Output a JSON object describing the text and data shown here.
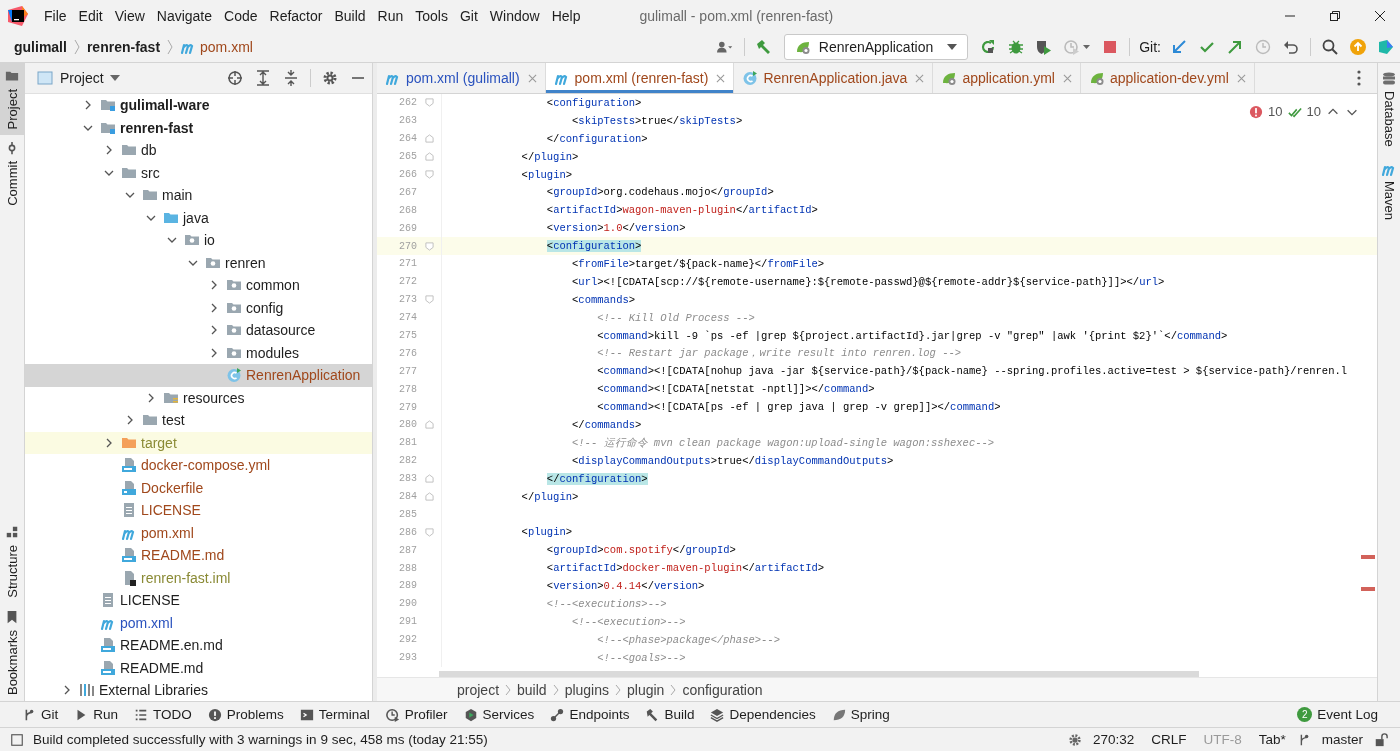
{
  "window": {
    "title": "gulimall - pom.xml (renren-fast)"
  },
  "menu": [
    "File",
    "Edit",
    "View",
    "Navigate",
    "Code",
    "Refactor",
    "Build",
    "Run",
    "Tools",
    "Git",
    "Window",
    "Help"
  ],
  "breadcrumbs": [
    {
      "label": "gulimall",
      "kind": "module"
    },
    {
      "label": "renren-fast",
      "kind": "module"
    },
    {
      "label": "pom.xml",
      "kind": "file"
    }
  ],
  "toolbar": {
    "run_config": "RenrenApplication",
    "git_label": "Git:"
  },
  "left_stripe": [
    {
      "label": "Project",
      "selected": true
    },
    {
      "label": "Commit",
      "selected": false
    }
  ],
  "left_stripe_bottom": [
    {
      "label": "Structure",
      "selected": false
    },
    {
      "label": "Bookmarks",
      "selected": false
    }
  ],
  "project_panel": {
    "title": "Project",
    "tree": [
      {
        "label": "gulimall-ware",
        "kind": "module",
        "color": "#1e1e1e",
        "expanded": false,
        "selected": false
      },
      {
        "label": "renren-fast",
        "kind": "module",
        "color": "#1e1e1e",
        "expanded": true,
        "selected": false,
        "children": [
          {
            "label": "db",
            "kind": "folder",
            "color": "#1e1e1e",
            "expanded": false,
            "selected": false
          },
          {
            "label": "src",
            "kind": "folder",
            "color": "#1e1e1e",
            "expanded": true,
            "selected": false,
            "children": [
              {
                "label": "main",
                "kind": "folder",
                "color": "#1e1e1e",
                "expanded": true,
                "selected": false,
                "children": [
                  {
                    "label": "java",
                    "kind": "source",
                    "color": "#1e1e1e",
                    "expanded": true,
                    "selected": false,
                    "children": [
                      {
                        "label": "io",
                        "kind": "package",
                        "color": "#1e1e1e",
                        "expanded": true,
                        "selected": false,
                        "children": [
                          {
                            "label": "renren",
                            "kind": "package",
                            "color": "#1e1e1e",
                            "expanded": true,
                            "selected": false,
                            "children": [
                              {
                                "label": "common",
                                "kind": "package",
                                "color": "#1e1e1e",
                                "expanded": false,
                                "selected": false
                              },
                              {
                                "label": "config",
                                "kind": "package",
                                "color": "#1e1e1e",
                                "expanded": false,
                                "selected": false
                              },
                              {
                                "label": "datasource",
                                "kind": "package",
                                "color": "#1e1e1e",
                                "expanded": false,
                                "selected": false
                              },
                              {
                                "label": "modules",
                                "kind": "package",
                                "color": "#1e1e1e",
                                "expanded": false,
                                "selected": false
                              },
                              {
                                "label": "RenrenApplication",
                                "kind": "class",
                                "color": "#a0481c",
                                "selected": true
                              }
                            ]
                          }
                        ]
                      }
                    ]
                  },
                  {
                    "label": "resources",
                    "kind": "resources",
                    "color": "#1e1e1e",
                    "expanded": false,
                    "selected": false
                  }
                ]
              },
              {
                "label": "test",
                "kind": "folder",
                "color": "#1e1e1e",
                "expanded": false,
                "selected": false
              }
            ]
          },
          {
            "label": "target",
            "kind": "excluded",
            "color": "#8a8a35",
            "expanded": false,
            "selected": false
          },
          {
            "label": "docker-compose.yml",
            "kind": "compose",
            "color": "#a0481c",
            "selected": false
          },
          {
            "label": "Dockerfile",
            "kind": "dockerfile",
            "color": "#a0481c",
            "selected": false
          },
          {
            "label": "LICENSE",
            "kind": "text",
            "color": "#a0481c",
            "selected": false
          },
          {
            "label": "pom.xml",
            "kind": "maven",
            "color": "#a0481c",
            "selected": false
          },
          {
            "label": "README.md",
            "kind": "markdown",
            "color": "#a0481c",
            "selected": false
          },
          {
            "label": "renren-fast.iml",
            "kind": "iml",
            "color": "#8a8a35",
            "selected": false
          }
        ]
      },
      {
        "label": "LICENSE",
        "kind": "text",
        "color": "#1e1e1e",
        "selected": false
      },
      {
        "label": "pom.xml",
        "kind": "maven",
        "color": "#2a52be",
        "selected": false
      },
      {
        "label": "README.en.md",
        "kind": "markdown",
        "color": "#1e1e1e",
        "selected": false
      },
      {
        "label": "README.md",
        "kind": "markdown",
        "color": "#1e1e1e",
        "selected": false
      }
    ],
    "libraries": {
      "label": "External Libraries",
      "expanded": false
    }
  },
  "tabs": [
    {
      "label": "pom.xml (gulimall)",
      "kind": "maven",
      "color": "#2a52be",
      "selected": false
    },
    {
      "label": "pom.xml (renren-fast)",
      "kind": "maven",
      "color": "#a0481c",
      "selected": true
    },
    {
      "label": "RenrenApplication.java",
      "kind": "class",
      "color": "#a0481c",
      "selected": false
    },
    {
      "label": "application.yml",
      "kind": "spring",
      "color": "#a0481c",
      "selected": false
    },
    {
      "label": "application-dev.yml",
      "kind": "spring",
      "color": "#a0481c",
      "selected": false
    }
  ],
  "editor": {
    "errors": "10",
    "checks": "10",
    "lines": [
      {
        "num": "262",
        "current": false,
        "kind": "fold_start",
        "code": [
          {
            "kind": "plain",
            "text": "                <"
          },
          {
            "kind": "tag",
            "text": "configuration"
          },
          {
            "kind": "plain",
            "text": ">"
          }
        ]
      },
      {
        "num": "263",
        "current": false,
        "kind": "plain",
        "code": [
          {
            "kind": "plain",
            "text": "                    <"
          },
          {
            "kind": "tag",
            "text": "skipTests"
          },
          {
            "kind": "plain",
            "text": ">true</"
          },
          {
            "kind": "tag",
            "text": "skipTests"
          },
          {
            "kind": "plain",
            "text": ">"
          }
        ]
      },
      {
        "num": "264",
        "current": false,
        "kind": "fold_end",
        "code": [
          {
            "kind": "plain",
            "text": "                </"
          },
          {
            "kind": "tag",
            "text": "configuration"
          },
          {
            "kind": "plain",
            "text": ">"
          }
        ]
      },
      {
        "num": "265",
        "current": false,
        "kind": "fold_end",
        "code": [
          {
            "kind": "plain",
            "text": "            </"
          },
          {
            "kind": "tag",
            "text": "plugin"
          },
          {
            "kind": "plain",
            "text": ">"
          }
        ]
      },
      {
        "num": "266",
        "current": false,
        "kind": "fold_start",
        "code": [
          {
            "kind": "plain",
            "text": "            <"
          },
          {
            "kind": "tag",
            "text": "plugin"
          },
          {
            "kind": "plain",
            "text": ">"
          }
        ]
      },
      {
        "num": "267",
        "current": false,
        "kind": "plain",
        "code": [
          {
            "kind": "plain",
            "text": "                <"
          },
          {
            "kind": "tag",
            "text": "groupId"
          },
          {
            "kind": "plain",
            "text": ">org.codehaus.mojo</"
          },
          {
            "kind": "tag",
            "text": "groupId"
          },
          {
            "kind": "plain",
            "text": ">"
          }
        ]
      },
      {
        "num": "268",
        "current": false,
        "kind": "plain",
        "code": [
          {
            "kind": "plain",
            "text": "                <"
          },
          {
            "kind": "tag",
            "text": "artifactId"
          },
          {
            "kind": "plain",
            "text": ">"
          },
          {
            "kind": "value",
            "text": "wagon-maven-plugin"
          },
          {
            "kind": "plain",
            "text": "</"
          },
          {
            "kind": "tag",
            "text": "artifactId"
          },
          {
            "kind": "plain",
            "text": ">"
          }
        ]
      },
      {
        "num": "269",
        "current": false,
        "kind": "plain",
        "code": [
          {
            "kind": "plain",
            "text": "                <"
          },
          {
            "kind": "tag",
            "text": "version"
          },
          {
            "kind": "plain",
            "text": ">"
          },
          {
            "kind": "value",
            "text": "1.0"
          },
          {
            "kind": "plain",
            "text": "</"
          },
          {
            "kind": "tag",
            "text": "version"
          },
          {
            "kind": "plain",
            "text": ">"
          }
        ]
      },
      {
        "num": "270",
        "current": true,
        "kind": "fold_start",
        "code": [
          {
            "kind": "match_plain",
            "text": "                <"
          },
          {
            "kind": "match_tag",
            "text": "configuration"
          },
          {
            "kind": "match_plain",
            "text": ">"
          }
        ]
      },
      {
        "num": "271",
        "current": false,
        "kind": "plain",
        "code": [
          {
            "kind": "plain",
            "text": "                    <"
          },
          {
            "kind": "tag",
            "text": "fromFile"
          },
          {
            "kind": "plain",
            "text": ">target/${pack-name}</"
          },
          {
            "kind": "tag",
            "text": "fromFile"
          },
          {
            "kind": "plain",
            "text": ">"
          }
        ]
      },
      {
        "num": "272",
        "current": false,
        "kind": "plain",
        "code": [
          {
            "kind": "plain",
            "text": "                    <"
          },
          {
            "kind": "tag",
            "text": "url"
          },
          {
            "kind": "plain",
            "text": "><![CDATA[scp://${remote-username}:${remote-passwd}@${remote-addr}${service-path}]]></"
          },
          {
            "kind": "tag",
            "text": "url"
          },
          {
            "kind": "plain",
            "text": ">"
          }
        ]
      },
      {
        "num": "273",
        "current": false,
        "kind": "fold_start",
        "code": [
          {
            "kind": "plain",
            "text": "                    <"
          },
          {
            "kind": "tag",
            "text": "commands"
          },
          {
            "kind": "plain",
            "text": ">"
          }
        ]
      },
      {
        "num": "274",
        "current": false,
        "kind": "plain",
        "code": [
          {
            "kind": "comment",
            "text": "                        <!-- Kill Old Process -->"
          }
        ]
      },
      {
        "num": "275",
        "current": false,
        "kind": "plain",
        "code": [
          {
            "kind": "plain",
            "text": "                        <"
          },
          {
            "kind": "tag",
            "text": "command"
          },
          {
            "kind": "plain",
            "text": ">kill -9 `ps -ef |grep ${project.artifactId}.jar|grep -v \"grep\" |awk '{print $2}'`</"
          },
          {
            "kind": "tag",
            "text": "command"
          },
          {
            "kind": "plain",
            "text": ">"
          }
        ]
      },
      {
        "num": "276",
        "current": false,
        "kind": "plain",
        "code": [
          {
            "kind": "comment",
            "text": "                        <!-- Restart jar package，write result into renren.log -->"
          }
        ]
      },
      {
        "num": "277",
        "current": false,
        "kind": "plain",
        "code": [
          {
            "kind": "plain",
            "text": "                        <"
          },
          {
            "kind": "tag",
            "text": "command"
          },
          {
            "kind": "plain",
            "text": "><![CDATA[nohup java -jar ${service-path}/${pack-name} --spring.profiles.active=test > ${service-path}/renren.l"
          }
        ]
      },
      {
        "num": "278",
        "current": false,
        "kind": "plain",
        "code": [
          {
            "kind": "plain",
            "text": "                        <"
          },
          {
            "kind": "tag",
            "text": "command"
          },
          {
            "kind": "plain",
            "text": "><![CDATA[netstat -nptl]]></"
          },
          {
            "kind": "tag",
            "text": "command"
          },
          {
            "kind": "plain",
            "text": ">"
          }
        ]
      },
      {
        "num": "279",
        "current": false,
        "kind": "plain",
        "code": [
          {
            "kind": "plain",
            "text": "                        <"
          },
          {
            "kind": "tag",
            "text": "command"
          },
          {
            "kind": "plain",
            "text": "><![CDATA[ps -ef | grep java | grep -v grep]]></"
          },
          {
            "kind": "tag",
            "text": "command"
          },
          {
            "kind": "plain",
            "text": ">"
          }
        ]
      },
      {
        "num": "280",
        "current": false,
        "kind": "fold_end",
        "code": [
          {
            "kind": "plain",
            "text": "                    </"
          },
          {
            "kind": "tag",
            "text": "commands"
          },
          {
            "kind": "plain",
            "text": ">"
          }
        ]
      },
      {
        "num": "281",
        "current": false,
        "kind": "plain",
        "code": [
          {
            "kind": "comment",
            "text": "                    <!-- 运行命令 mvn clean package wagon:upload-single wagon:sshexec-->"
          }
        ]
      },
      {
        "num": "282",
        "current": false,
        "kind": "plain",
        "code": [
          {
            "kind": "plain",
            "text": "                    <"
          },
          {
            "kind": "tag",
            "text": "displayCommandOutputs"
          },
          {
            "kind": "plain",
            "text": ">true</"
          },
          {
            "kind": "tag",
            "text": "displayCommandOutputs"
          },
          {
            "kind": "plain",
            "text": ">"
          }
        ]
      },
      {
        "num": "283",
        "current": false,
        "kind": "fold_end",
        "code": [
          {
            "kind": "match_plain",
            "text": "                </"
          },
          {
            "kind": "match_tag",
            "text": "configuration"
          },
          {
            "kind": "match_plain",
            "text": ">"
          }
        ]
      },
      {
        "num": "284",
        "current": false,
        "kind": "fold_end",
        "code": [
          {
            "kind": "plain",
            "text": "            </"
          },
          {
            "kind": "tag",
            "text": "plugin"
          },
          {
            "kind": "plain",
            "text": ">"
          }
        ]
      },
      {
        "num": "285",
        "current": false,
        "kind": "plain"
      },
      {
        "num": "286",
        "current": false,
        "kind": "fold_start",
        "code": [
          {
            "kind": "plain",
            "text": "            <"
          },
          {
            "kind": "tag",
            "text": "plugin"
          },
          {
            "kind": "plain",
            "text": ">"
          }
        ]
      },
      {
        "num": "287",
        "current": false,
        "kind": "plain",
        "code": [
          {
            "kind": "plain",
            "text": "                <"
          },
          {
            "kind": "tag",
            "text": "groupId"
          },
          {
            "kind": "plain",
            "text": ">"
          },
          {
            "kind": "value",
            "text": "com.spotify"
          },
          {
            "kind": "plain",
            "text": "</"
          },
          {
            "kind": "tag",
            "text": "groupId"
          },
          {
            "kind": "plain",
            "text": ">"
          }
        ]
      },
      {
        "num": "288",
        "current": false,
        "kind": "plain",
        "code": [
          {
            "kind": "plain",
            "text": "                <"
          },
          {
            "kind": "tag",
            "text": "artifactId"
          },
          {
            "kind": "plain",
            "text": ">"
          },
          {
            "kind": "value",
            "text": "docker-maven-plugin"
          },
          {
            "kind": "plain",
            "text": "</"
          },
          {
            "kind": "tag",
            "text": "artifactId"
          },
          {
            "kind": "plain",
            "text": ">"
          }
        ]
      },
      {
        "num": "289",
        "current": false,
        "kind": "plain",
        "code": [
          {
            "kind": "plain",
            "text": "                <"
          },
          {
            "kind": "tag",
            "text": "version"
          },
          {
            "kind": "plain",
            "text": ">"
          },
          {
            "kind": "value",
            "text": "0.4.14"
          },
          {
            "kind": "plain",
            "text": "</"
          },
          {
            "kind": "tag",
            "text": "version"
          },
          {
            "kind": "plain",
            "text": ">"
          }
        ]
      },
      {
        "num": "290",
        "current": false,
        "kind": "plain",
        "code": [
          {
            "kind": "comment",
            "text": "                <!--<executions>-->"
          }
        ]
      },
      {
        "num": "291",
        "current": false,
        "kind": "plain",
        "code": [
          {
            "kind": "comment",
            "text": "                    <!--<execution>-->"
          }
        ]
      },
      {
        "num": "292",
        "current": false,
        "kind": "plain",
        "code": [
          {
            "kind": "comment",
            "text": "                        <!--<phase>package</phase>-->"
          }
        ]
      },
      {
        "num": "293",
        "current": false,
        "kind": "plain",
        "code": [
          {
            "kind": "comment",
            "text": "                        <!--<goals>-->"
          }
        ]
      }
    ],
    "path": [
      "project",
      "build",
      "plugins",
      "plugin",
      "configuration"
    ]
  },
  "right_stripe": [
    {
      "label": "Database",
      "kind": "database"
    },
    {
      "label": "Maven",
      "kind": "maven"
    }
  ],
  "tool_windows": [
    {
      "label": "Git",
      "kind": "git"
    },
    {
      "label": "Run",
      "kind": "run"
    },
    {
      "label": "TODO",
      "kind": "todo"
    },
    {
      "label": "Problems",
      "kind": "problems"
    },
    {
      "label": "Terminal",
      "kind": "terminal"
    },
    {
      "label": "Profiler",
      "kind": "profiler"
    },
    {
      "label": "Services",
      "kind": "services"
    },
    {
      "label": "Endpoints",
      "kind": "endpoints"
    },
    {
      "label": "Build",
      "kind": "build"
    },
    {
      "label": "Dependencies",
      "kind": "dependencies"
    },
    {
      "label": "Spring",
      "kind": "spring"
    }
  ],
  "event_log": {
    "label": "Event Log",
    "badge": "2"
  },
  "status_bar": {
    "message": "Build completed successfully with 3 warnings in 9 sec, 458 ms (today 21:55)",
    "items": [
      {
        "label": "270:32",
        "kind": "position",
        "disabled": false
      },
      {
        "label": "CRLF",
        "kind": "text",
        "disabled": false
      },
      {
        "label": "UTF-8",
        "kind": "text",
        "disabled": true
      },
      {
        "label": "Tab*",
        "kind": "text",
        "disabled": false
      },
      {
        "label": "master",
        "kind": "branch",
        "disabled": false
      }
    ]
  }
}
